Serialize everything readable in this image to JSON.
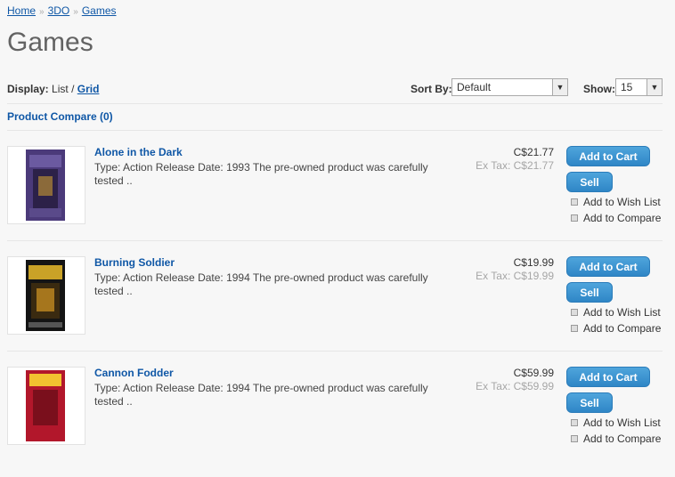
{
  "breadcrumb": {
    "items": [
      "Home",
      "3DO",
      "Games"
    ],
    "separator": "»"
  },
  "page_title": "Games",
  "toolbar": {
    "display_label": "Display:",
    "list_label": "List",
    "divider": "/",
    "grid_label": "Grid",
    "sort_label": "Sort By:",
    "sort_value": "Default",
    "show_label": "Show:",
    "show_value": "15"
  },
  "compare_link": "Product Compare (0)",
  "products": [
    {
      "name": "Alone in the Dark",
      "desc": "Type: Action   Release Date: 1993 The pre-owned product was carefully tested ..",
      "price": "C$21.77",
      "extax": "Ex Tax: C$21.77",
      "cart": "Add to Cart",
      "sell": "Sell",
      "wish": "Add to Wish List",
      "compare": "Add to Compare",
      "cover_color": "#3a2a63"
    },
    {
      "name": "Burning Soldier",
      "desc": "Type: Action   Release Date: 1994 The pre-owned product was carefully tested ..",
      "price": "C$19.99",
      "extax": "Ex Tax: C$19.99",
      "cart": "Add to Cart",
      "sell": "Sell",
      "wish": "Add to Wish List",
      "compare": "Add to Compare",
      "cover_color": "#1a1a1a"
    },
    {
      "name": "Cannon Fodder",
      "desc": "Type: Action   Release Date: 1994 The pre-owned product was carefully tested ..",
      "price": "C$59.99",
      "extax": "Ex Tax: C$59.99",
      "cart": "Add to Cart",
      "sell": "Sell",
      "wish": "Add to Wish List",
      "compare": "Add to Compare",
      "cover_color": "#b2172b"
    }
  ],
  "colors": {
    "link": "#0f57a6",
    "button": "#2f86c6"
  }
}
